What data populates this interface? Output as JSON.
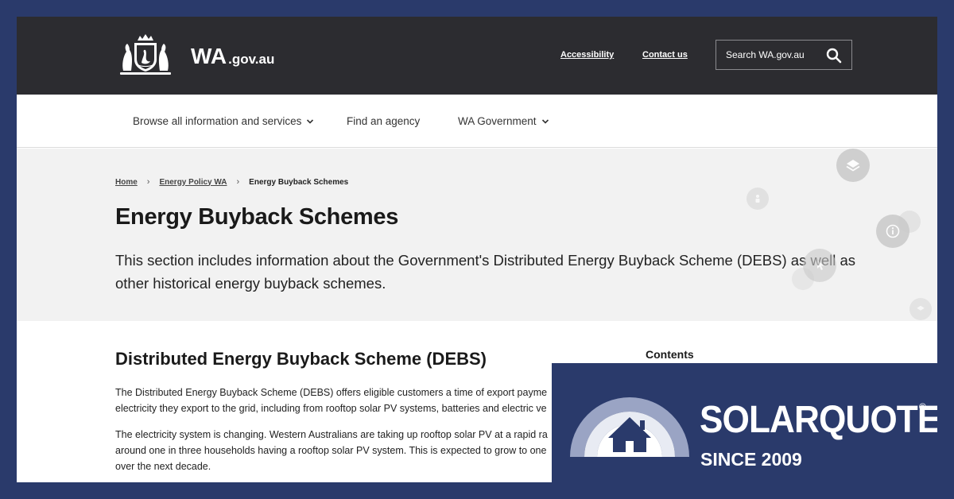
{
  "header": {
    "logo_main": "WA",
    "logo_suffix": ".gov.au",
    "links": {
      "accessibility": "Accessibility",
      "contact": "Contact us"
    },
    "search": {
      "placeholder": "Search WA.gov.au"
    }
  },
  "nav": {
    "items": [
      {
        "label": "Browse all information and services",
        "has_dropdown": true
      },
      {
        "label": "Find an agency",
        "has_dropdown": false
      },
      {
        "label": "WA Government",
        "has_dropdown": true
      }
    ]
  },
  "breadcrumb": {
    "home": "Home",
    "parent": "Energy Policy WA",
    "current": "Energy Buyback Schemes"
  },
  "hero": {
    "title": "Energy Buyback Schemes",
    "intro": "This section includes information about the Government's Distributed Energy Buyback Scheme (DEBS) as well as other historical energy buyback schemes."
  },
  "content": {
    "section_title": "Distributed Energy Buyback Scheme (DEBS)",
    "para1_line1": "The Distributed Energy Buyback Scheme (DEBS) offers eligible customers a time of export payme",
    "para1_line2": "electricity they export to the grid, including from rooftop solar PV systems, batteries and electric ve",
    "para2_line1": "The electricity system is changing. Western Australians are taking up rooftop solar PV at a rapid ra",
    "para2_line2": "around one in three households having a rooftop solar PV system. This is expected to grow to one",
    "para2_line3": "over the next decade.",
    "contents_label": "Contents"
  },
  "badge": {
    "name": "SOLARQUOTES",
    "registered": "®",
    "since": "SINCE 2009"
  },
  "colors": {
    "background": "#2a3a6b",
    "header": "#2c2c30",
    "hero": "#f2f2f2"
  }
}
